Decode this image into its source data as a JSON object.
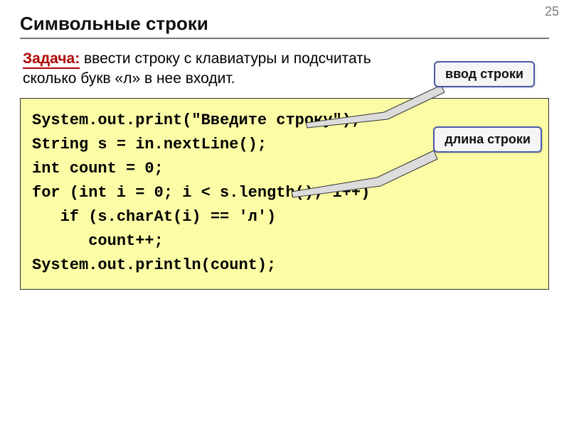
{
  "page_number": "25",
  "title": "Символьные строки",
  "task": {
    "label": "Задача:",
    "text_part1": " ввести строку с клавиатуры и подсчитать",
    "text_part2": "сколько букв «л» в нее входит."
  },
  "callouts": {
    "c1": "ввод строки",
    "c2": "длина строки"
  },
  "code": {
    "l1": "System.out.print(\"Введите строку\");",
    "l2": "String s = in.nextLine();",
    "l3": "int count = 0;",
    "l4": "for (int i = 0; i < s.length(); i++)",
    "l5": "   if (s.charAt(i) == 'л')",
    "l6": "      count++;",
    "l7": "System.out.println(count);"
  }
}
